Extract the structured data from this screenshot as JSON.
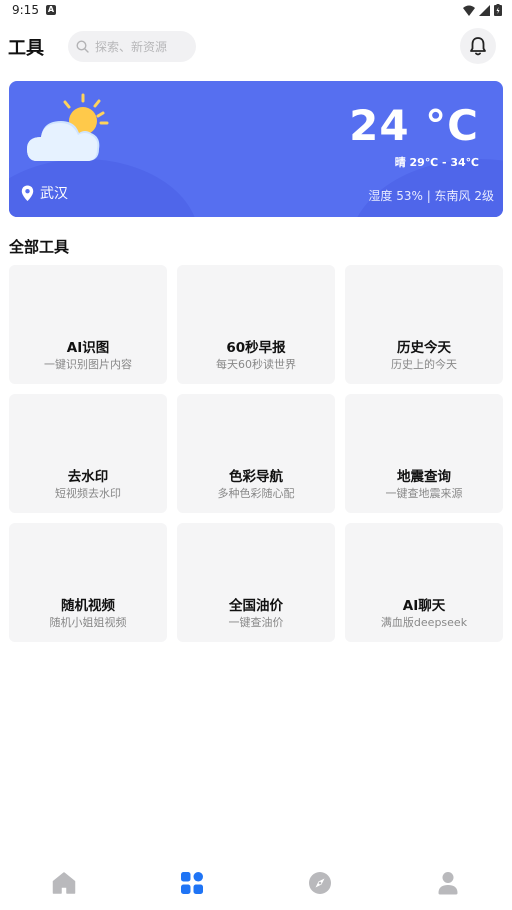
{
  "status": {
    "time": "9:15",
    "notif_letter": "A"
  },
  "header": {
    "title": "工具",
    "search_placeholder": "探索、新资源"
  },
  "weather": {
    "temperature": "24 °C",
    "condition": "晴 29℃ - 34℃",
    "location": "武汉",
    "details": "湿度 53% | 东南风 2级"
  },
  "section": {
    "title": "全部工具"
  },
  "tools": [
    {
      "title": "AI识图",
      "subtitle": "一键识别图片内容"
    },
    {
      "title": "60秒早报",
      "subtitle": "每天60秒读世界"
    },
    {
      "title": "历史今天",
      "subtitle": "历史上的今天"
    },
    {
      "title": "去水印",
      "subtitle": "短视频去水印"
    },
    {
      "title": "色彩导航",
      "subtitle": "多种色彩随心配"
    },
    {
      "title": "地震查询",
      "subtitle": "一键查地震来源"
    },
    {
      "title": "随机视频",
      "subtitle": "随机小姐姐视频"
    },
    {
      "title": "全国油价",
      "subtitle": "一键查油价"
    },
    {
      "title": "AI聊天",
      "subtitle": "满血版deepseek"
    }
  ],
  "nav": {
    "items": [
      {
        "icon": "home-icon",
        "active": false
      },
      {
        "icon": "grid-icon",
        "active": true
      },
      {
        "icon": "compass-icon",
        "active": false
      },
      {
        "icon": "user-icon",
        "active": false
      }
    ],
    "active_color": "#1f74f5",
    "inactive_color": "#b9b9bc"
  },
  "colors": {
    "weather_card": "#566ff0",
    "tile_bg": "#f5f5f6"
  }
}
